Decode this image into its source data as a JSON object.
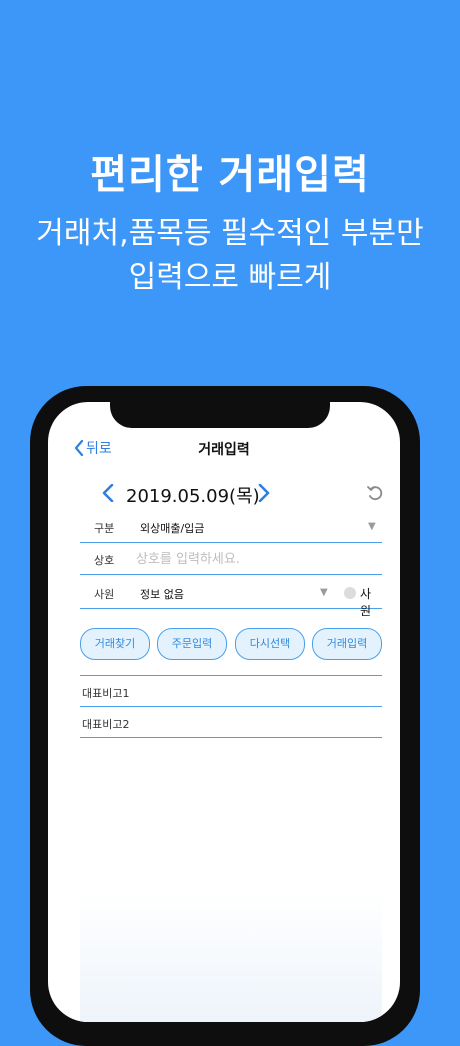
{
  "promo": {
    "title": "편리한 거래입력",
    "subtitle_line1": "거래처,품목등 필수적인 부분만",
    "subtitle_line2": "입력으로 빠르게"
  },
  "navbar": {
    "back_label": "뒤로",
    "title": "거래입력"
  },
  "date": {
    "value": "2019.05.09(목)"
  },
  "form": {
    "category": {
      "label": "구분",
      "value": "외상매출/입금"
    },
    "company": {
      "label": "상호",
      "placeholder": "상호를 입력하세요."
    },
    "employee": {
      "label": "사원",
      "value": "정보 없음",
      "radio_label": "사원"
    }
  },
  "buttons": [
    "거래찾기",
    "주문입력",
    "다시선택",
    "거래입력"
  ],
  "memos": [
    {
      "label": "대표비고1"
    },
    {
      "label": "대표비고2"
    }
  ],
  "colors": {
    "background": "#3d97f8",
    "accent": "#2f7fe0",
    "pill_fill": "#e4f2fd",
    "line": "#4aa0ea"
  }
}
